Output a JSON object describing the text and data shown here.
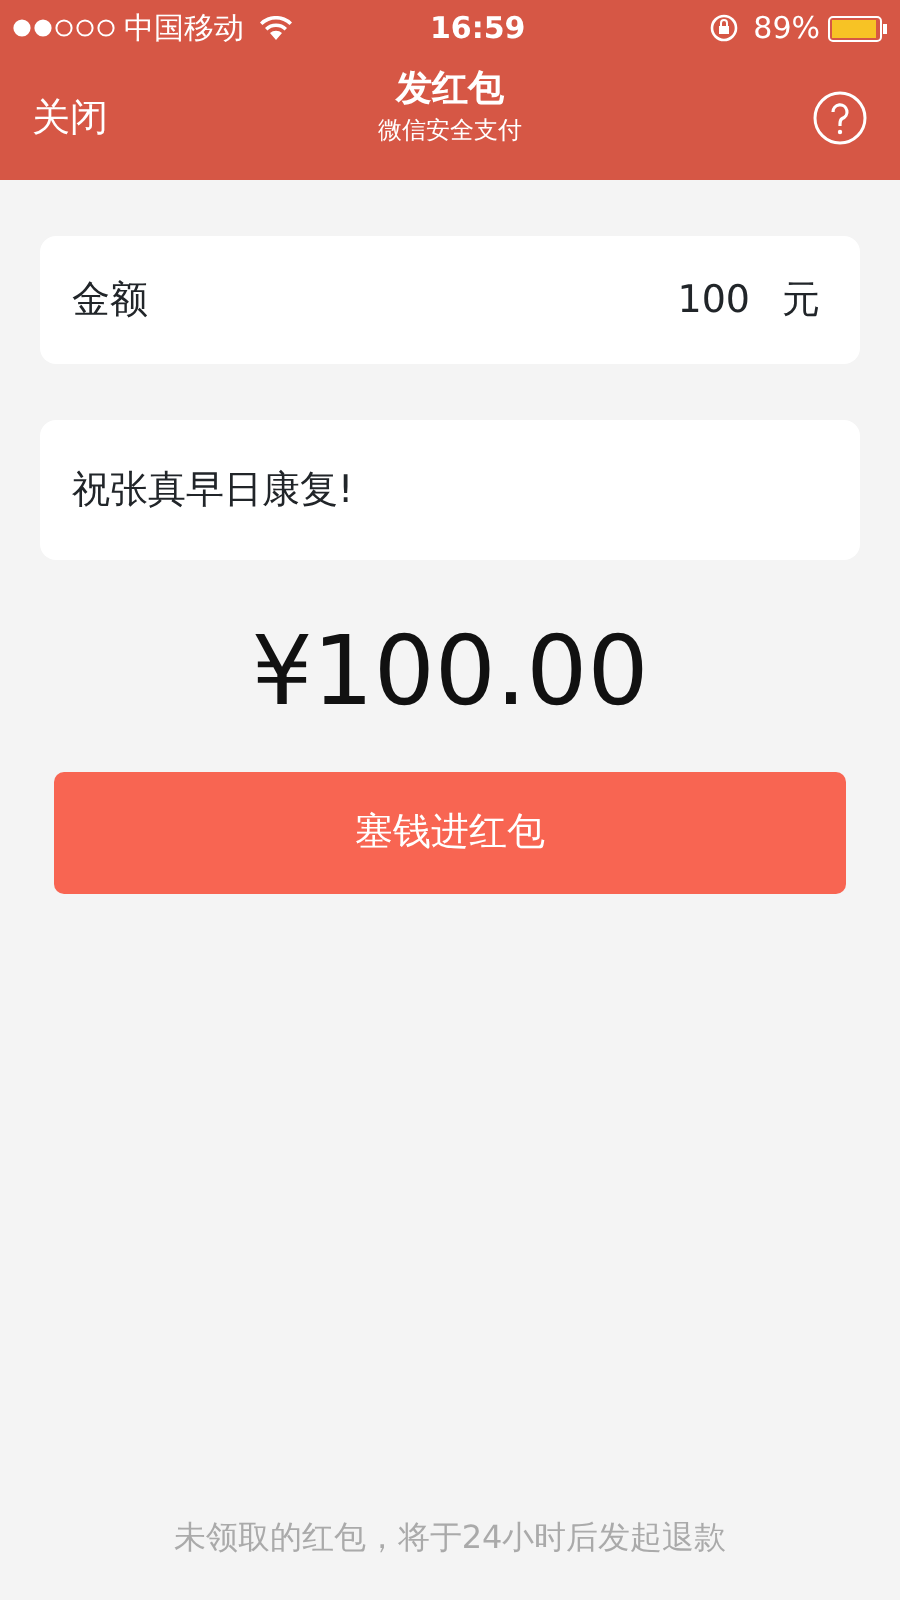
{
  "status_bar": {
    "carrier": "中国移动",
    "time": "16:59",
    "battery": "89%"
  },
  "nav": {
    "close": "关闭",
    "title": "发红包",
    "subtitle": "微信安全支付"
  },
  "amount_field": {
    "label": "金额",
    "value": "100",
    "unit": "元"
  },
  "message_field": {
    "value": "祝张真早日康复!"
  },
  "total": "¥100.00",
  "submit_button": "塞钱进红包",
  "footer": "未领取的红包，将于24小时后发起退款"
}
